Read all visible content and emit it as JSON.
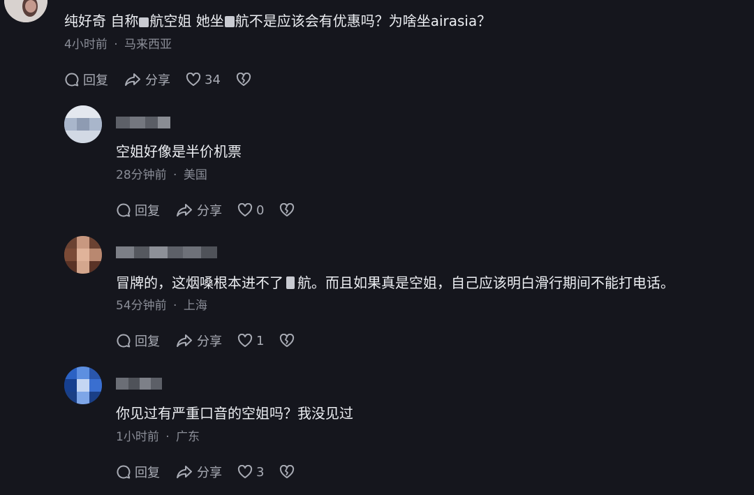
{
  "comments": [
    {
      "text_part1": "纯好奇 自称",
      "text_part2": "航空姐 她坐",
      "text_part3": "航不是应该会有优惠吗？为啥坐airasia？",
      "time": "4小时前",
      "location": "马来西亚",
      "reply_label": "回复",
      "share_label": "分享",
      "likes": "34"
    },
    {
      "text": "空姐好像是半价机票",
      "time": "28分钟前",
      "location": "美国",
      "reply_label": "回复",
      "share_label": "分享",
      "likes": "0"
    },
    {
      "text_part1": "冒牌的，这烟嗓根本进不了",
      "text_part2": "航。而且如果真是空姐，自己应该明白滑行期间不能打电话。",
      "time": "54分钟前",
      "location": "上海",
      "reply_label": "回复",
      "share_label": "分享",
      "likes": "1"
    },
    {
      "text": "你见过有严重口音的空姐吗？我没见过",
      "time": "1小时前",
      "location": "广东",
      "reply_label": "回复",
      "share_label": "分享",
      "likes": "3"
    }
  ],
  "meta_separator": "·",
  "icons": {
    "reply": "speech-bubble-icon",
    "share": "share-arrow-icon",
    "like": "heart-icon",
    "dislike": "broken-heart-icon"
  },
  "colors": {
    "background": "#15161d",
    "text": "#eceef2",
    "meta": "#8a8d97",
    "action": "#a9acb5"
  }
}
